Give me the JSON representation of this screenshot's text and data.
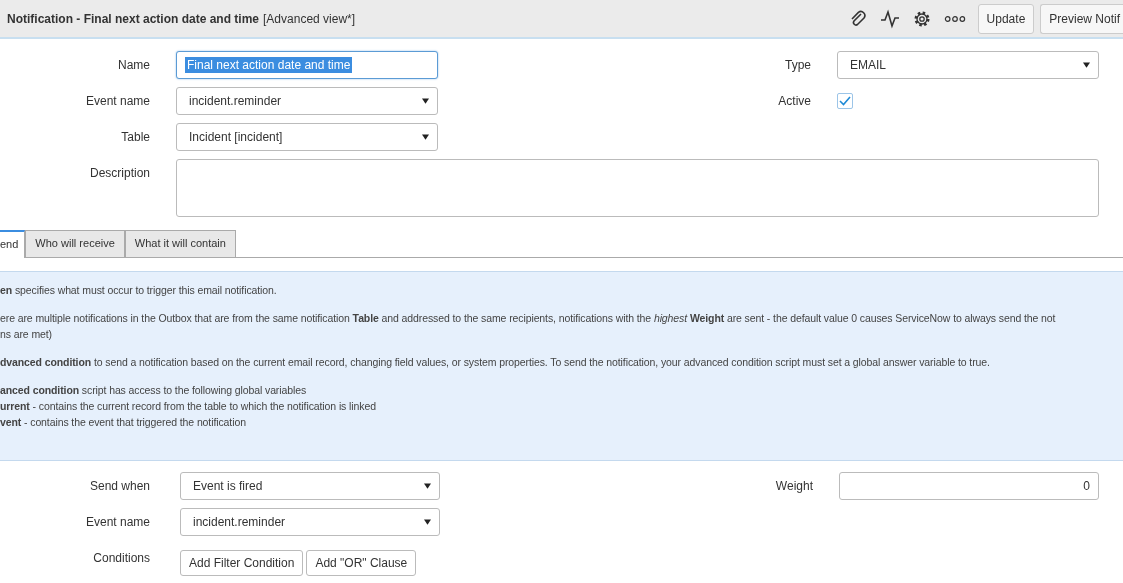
{
  "header": {
    "title": "Notification - Final next action date and time",
    "view": "[Advanced view*]",
    "buttons": [
      "Update",
      "Preview Notif"
    ]
  },
  "form": {
    "left": [
      {
        "label": "Name",
        "kind": "text",
        "value": "Final next action date and time",
        "selected": true
      },
      {
        "label": "Event name",
        "kind": "select",
        "value": "incident.reminder"
      },
      {
        "label": "Table",
        "kind": "select",
        "value": "Incident [incident]"
      }
    ],
    "right": [
      {
        "label": "Type",
        "kind": "select",
        "value": "EMAIL"
      },
      {
        "label": "Active",
        "kind": "checkbox",
        "checked": true
      }
    ],
    "description": {
      "label": "Description"
    }
  },
  "tabs": [
    {
      "label": "end",
      "selected": true
    },
    {
      "label": "Who will receive",
      "selected": false
    },
    {
      "label": "What it will contain",
      "selected": false
    }
  ],
  "info": [
    {
      "lines": [
        "**en** specifies what must occur to trigger this email notification."
      ]
    },
    {
      "lines": [
        "ere are multiple notifications in the Outbox that are from the same notification **Table** and addressed to the same recipients, notifications with the *highest* **Weight** are sent - the default value 0 causes ServiceNow to always send the not",
        "ns are met)"
      ]
    },
    {
      "lines": [
        "**dvanced condition** to send a notification based on the current email record, changing field values, or system properties. To send the notification, your advanced condition script must set a global answer variable to true."
      ]
    },
    {
      "lines": [
        "**anced condition** script has access to the following global variables",
        "**urrent** - contains the current record from the table to which the notification is linked",
        "**vent** - contains the event that triggered the notification"
      ]
    }
  ],
  "when": {
    "left": [
      {
        "label": "Send when",
        "kind": "select",
        "value": "Event is fired"
      },
      {
        "label": "Event name",
        "kind": "select",
        "value": "incident.reminder"
      },
      {
        "label": "Conditions",
        "kind": "buttons",
        "buttons": [
          "Add Filter Condition",
          "Add \"OR\" Clause"
        ]
      }
    ],
    "right": [
      {
        "label": "Weight",
        "kind": "number",
        "value": "0"
      }
    ]
  }
}
